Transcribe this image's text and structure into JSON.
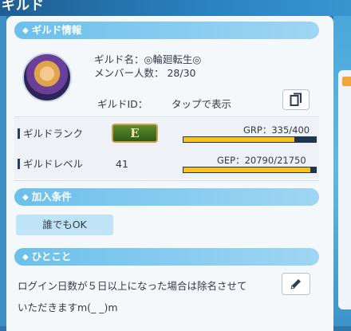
{
  "window": {
    "title": "ギルド"
  },
  "guild_info": {
    "header": "ギルド情報",
    "name_line": "ギルド名：◎輪廻転生◎",
    "members_line": "メンバー人数： 28/30",
    "id_label": "ギルドID：",
    "id_action": "タップで表示"
  },
  "rank": {
    "label": "ギルドランク",
    "badge": "E",
    "points_text": "GRP：335/400",
    "progress": 0.84
  },
  "level": {
    "label": "ギルドレベル",
    "value": "41",
    "points_text": "GEP：20790/21750",
    "progress": 0.956
  },
  "conditions": {
    "header": "加入条件",
    "value": "誰でもOK"
  },
  "comment": {
    "header": "ひとこと",
    "line1": "ログイン日数が５日以上になった場合は除名させて",
    "line2": "いただきますm(_ _)m"
  },
  "icons": {
    "copy": "copy-icon",
    "edit": "pencil-icon",
    "section_marker": "diamond-icon"
  },
  "colors": {
    "accent": "#6cc0ec",
    "bar_fill": "#f6c21b",
    "bar_track": "#1e3553",
    "badge_green": "#4a7a24"
  }
}
